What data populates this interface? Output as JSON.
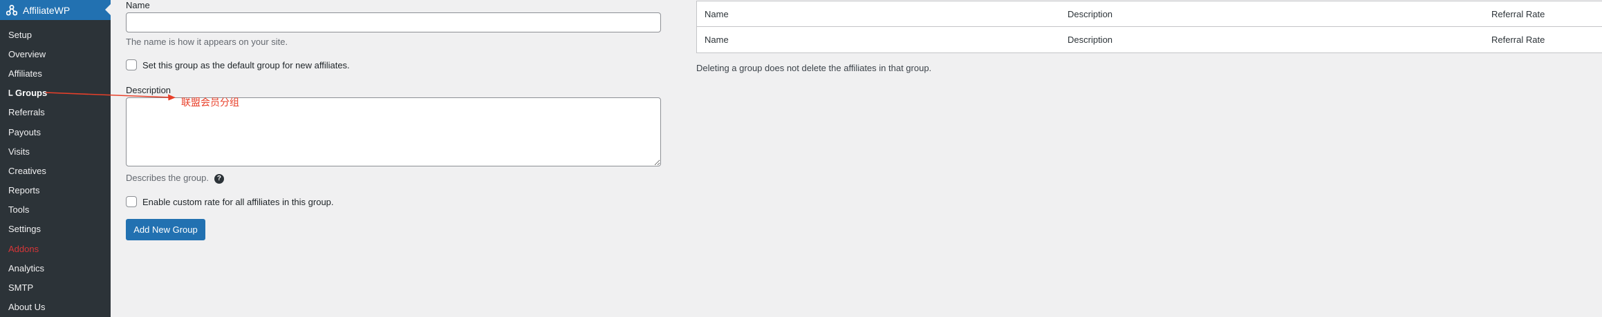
{
  "sidebar": {
    "brand": "AffiliateWP",
    "items": [
      {
        "label": "Setup",
        "state": "normal"
      },
      {
        "label": "Overview",
        "state": "normal"
      },
      {
        "label": "Affiliates",
        "state": "normal"
      },
      {
        "label": "Groups",
        "state": "current"
      },
      {
        "label": "Referrals",
        "state": "normal"
      },
      {
        "label": "Payouts",
        "state": "normal"
      },
      {
        "label": "Visits",
        "state": "normal"
      },
      {
        "label": "Creatives",
        "state": "normal"
      },
      {
        "label": "Reports",
        "state": "normal"
      },
      {
        "label": "Tools",
        "state": "normal"
      },
      {
        "label": "Settings",
        "state": "normal"
      },
      {
        "label": "Addons",
        "state": "highlight"
      },
      {
        "label": "Analytics",
        "state": "normal"
      },
      {
        "label": "SMTP",
        "state": "normal"
      },
      {
        "label": "About Us",
        "state": "normal"
      }
    ]
  },
  "form": {
    "name_label": "Name",
    "name_value": "",
    "name_help": "The name is how it appears on your site.",
    "default_group_label": "Set this group as the default group for new affiliates.",
    "default_group_checked": false,
    "description_label": "Description",
    "description_value": "",
    "description_help": "Describes the group.",
    "help_icon_glyph": "?",
    "custom_rate_label": "Enable custom rate for all affiliates in this group.",
    "custom_rate_checked": false,
    "submit_label": "Add New Group"
  },
  "annotation": {
    "text": "联盟会员分组",
    "color": "#e8402a"
  },
  "table": {
    "header": {
      "name": "Name",
      "description": "Description",
      "rate": "Referral Rate"
    },
    "footer": {
      "name": "Name",
      "description": "Description",
      "rate": "Referral Rate"
    },
    "note": "Deleting a group does not delete the affiliates in that group."
  },
  "colors": {
    "sidebar_bg": "#2c3338",
    "brand_blue": "#2271b1",
    "addons_red": "#d63638",
    "page_bg": "#f0f0f1"
  }
}
